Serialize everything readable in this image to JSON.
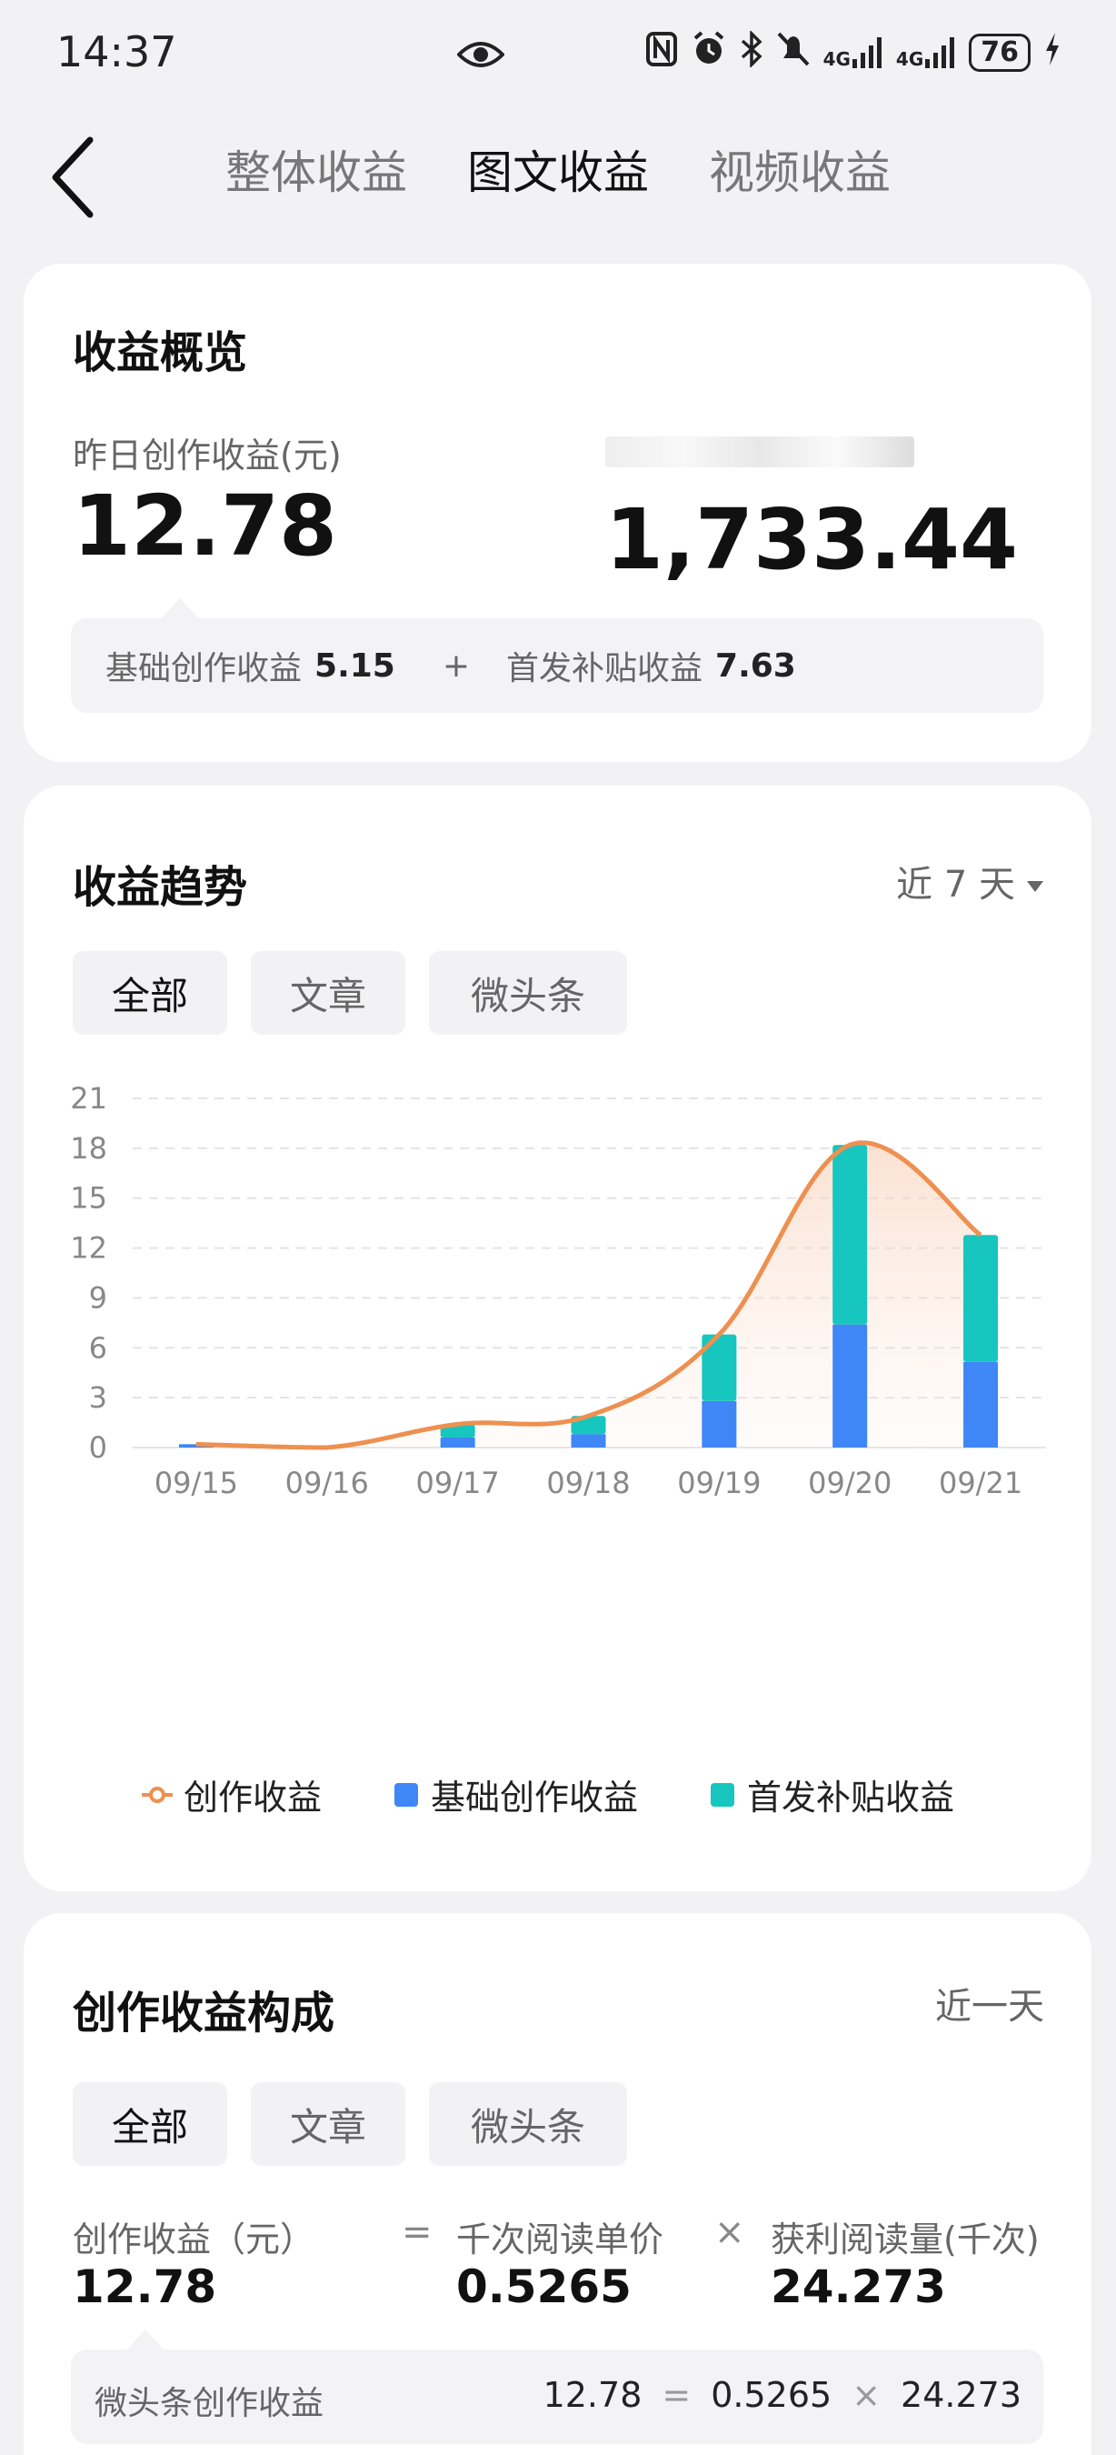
{
  "status_bar": {
    "time": "14:37",
    "battery": "76",
    "signal1": "4G",
    "signal2": "4G"
  },
  "nav": {
    "tabs": [
      "整体收益",
      "图文收益",
      "视频收益"
    ],
    "active_tab": 1
  },
  "overview": {
    "title": "收益概览",
    "yesterday_label": "昨日创作收益(元)",
    "yesterday_value": "12.78",
    "total_value": "1,733.44",
    "base_label": "基础创作收益",
    "base_value": "5.15",
    "plus": "+",
    "subsidy_label": "首发补贴收益",
    "subsidy_value": "7.63"
  },
  "trend": {
    "title": "收益趋势",
    "period": "近 7 天",
    "filters": [
      "全部",
      "文章",
      "微头条"
    ],
    "legend": {
      "line": "创作收益",
      "base": "基础创作收益",
      "subsidy": "首发补贴收益"
    }
  },
  "chart_data": {
    "type": "bar",
    "categories": [
      "09/15",
      "09/16",
      "09/17",
      "09/18",
      "09/19",
      "09/20",
      "09/21"
    ],
    "series": [
      {
        "name": "基础创作收益",
        "values": [
          0.2,
          0.0,
          0.6,
          0.8,
          2.8,
          7.4,
          5.15
        ]
      },
      {
        "name": "首发补贴收益",
        "values": [
          0.0,
          0.0,
          0.8,
          1.1,
          4.0,
          10.8,
          7.63
        ]
      },
      {
        "name": "创作收益",
        "values": [
          0.2,
          0.0,
          1.4,
          1.9,
          6.8,
          18.2,
          12.78
        ]
      }
    ],
    "ylim": [
      0,
      21
    ],
    "yticks": [
      0,
      3,
      6,
      9,
      12,
      15,
      18,
      21
    ],
    "grid": true,
    "legend_position": "bottom",
    "colors": {
      "base": "#3f86f6",
      "subsidy": "#16c6bf",
      "line": "#ee9050",
      "grid": "#e4e4e8",
      "tick": "#888888"
    }
  },
  "composition": {
    "title": "创作收益构成",
    "period": "近一天",
    "filters": [
      "全部",
      "文章",
      "微头条"
    ],
    "income_label": "创作收益（元）",
    "income_value": "12.78",
    "eq": "=",
    "price_label": "千次阅读单价",
    "price_value": "0.5265",
    "times": "×",
    "reads_label": "获利阅读量(千次)",
    "reads_value": "24.273",
    "sub_label": "微头条创作收益",
    "sub_income": "12.78",
    "sub_price": "0.5265",
    "sub_reads": "24.273"
  }
}
